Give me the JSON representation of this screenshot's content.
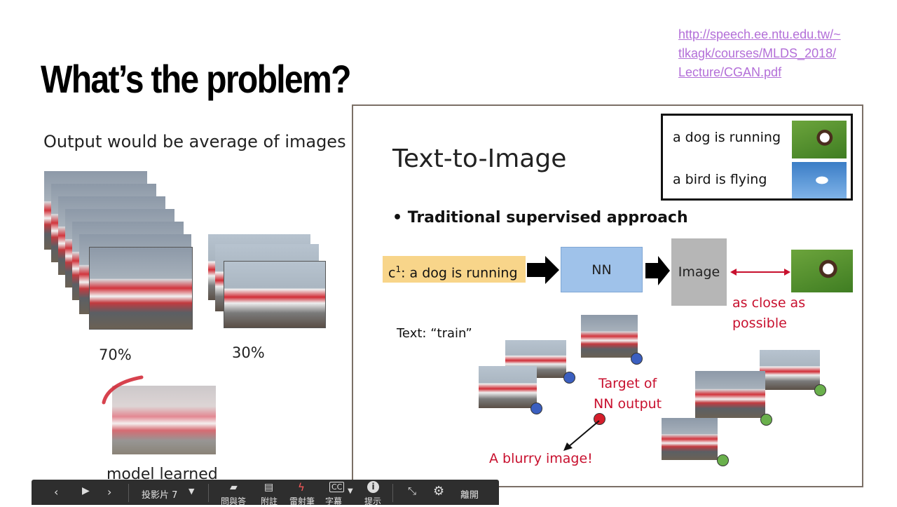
{
  "slide": {
    "title": "What’s the problem?",
    "link_lines": [
      "http://speech.ee.ntu.edu.tw/~",
      "tlkagk/courses/MLDS_2018/",
      "Lecture/CGAN.pdf"
    ],
    "subtitle": "Output would be average of images",
    "pct_left": "70%",
    "pct_right": "30%",
    "model_label": "model learned"
  },
  "inset": {
    "heading": "Text-to-Image",
    "examples": [
      {
        "text": "a dog is running"
      },
      {
        "text": "a bird is flying"
      }
    ],
    "bullet": "Traditional supervised approach",
    "input_prefix": "c",
    "input_sup": "1",
    "input_text": ": a dog is running",
    "nn_label": "NN",
    "image_label": "Image",
    "close_text": [
      "as close as",
      "possible"
    ],
    "train_text": "Text: “train”",
    "target_text": [
      "Target of",
      "NN output"
    ],
    "blurry_text": "A blurry image!"
  },
  "toolbar": {
    "slide_label": "投影片 7",
    "btn_qa": "問與答",
    "btn_notes": "附註",
    "btn_laser": "雷射筆",
    "btn_captions": "字幕",
    "btn_tips": "提示",
    "btn_exit": "離開"
  },
  "colors": {
    "link": "#b36fd8",
    "accent_red": "#c8102e",
    "nn_box": "#9fc2ea",
    "input_box": "#f8d58a",
    "toolbar_bg": "#2e2e2e"
  }
}
